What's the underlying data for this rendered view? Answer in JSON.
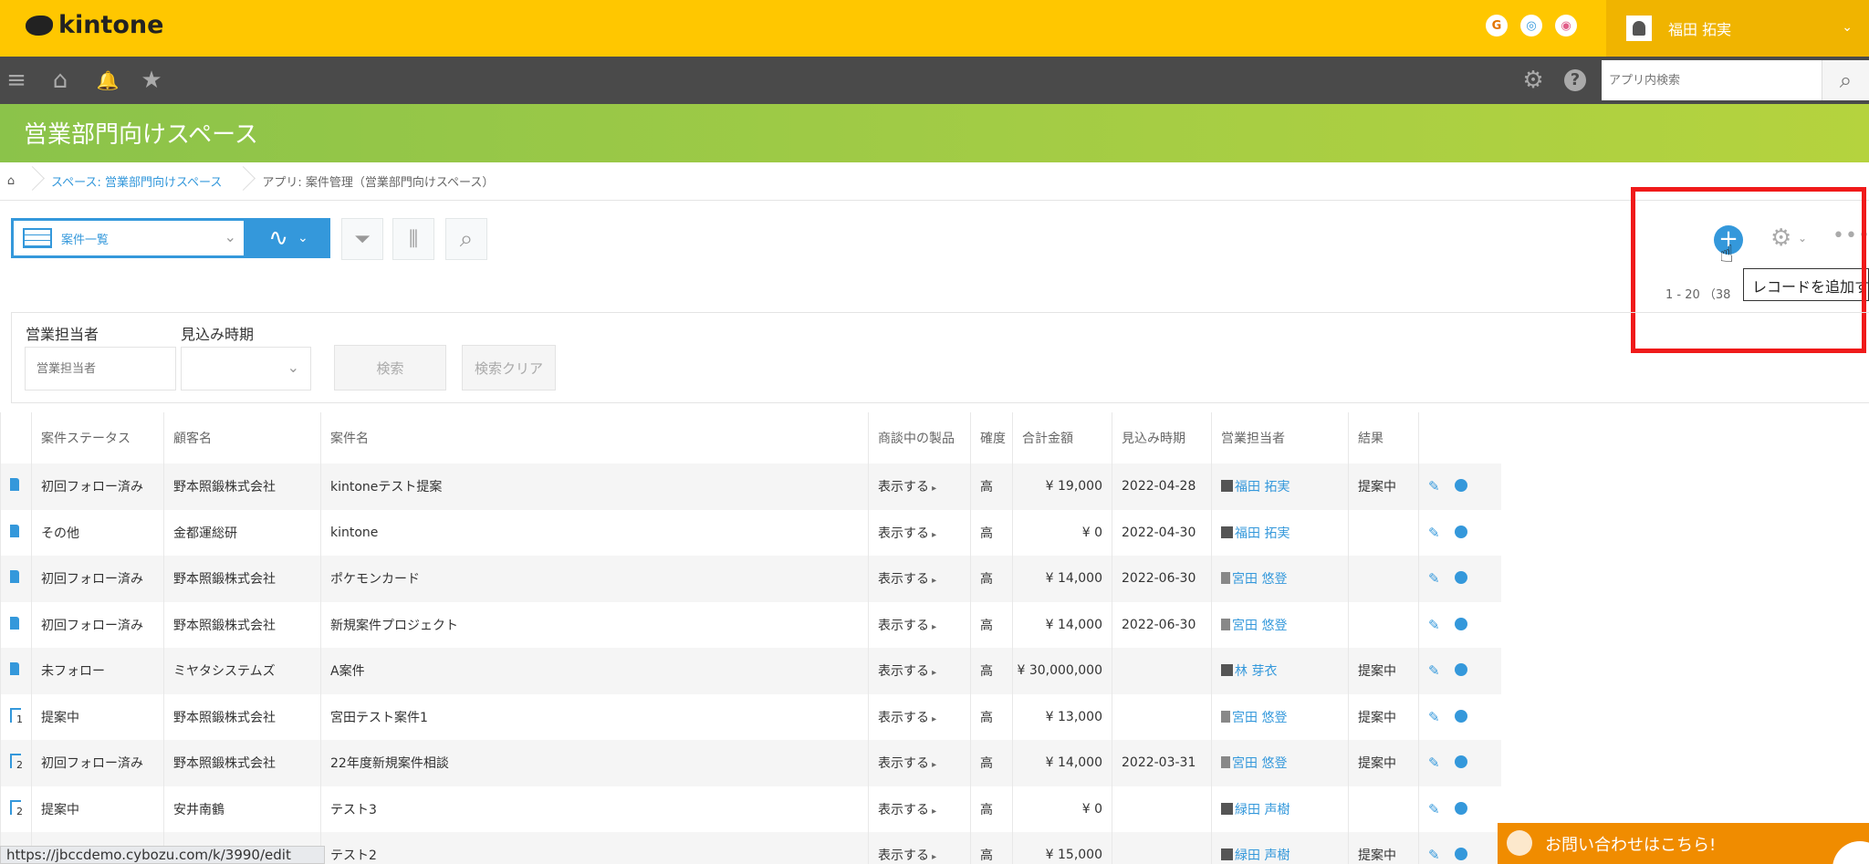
{
  "header": {
    "logo_text": "kintone",
    "service_icons": [
      "G",
      "◎",
      "◉"
    ],
    "user_name": "福田 拓実",
    "user_chevron": "⌄"
  },
  "navbar": {
    "menu_icon": "≡",
    "home_icon": "⌂",
    "bell_icon": "🔔",
    "star_icon": "★",
    "gear_icon": "⚙",
    "help_icon": "?",
    "search_placeholder": "アプリ内検索",
    "search_icon": "⌕"
  },
  "space": {
    "title": "営業部門向けスペース"
  },
  "breadcrumb": {
    "home_icon": "⌂",
    "space": "スペース: 営業部門向けスペース",
    "app": "アプリ: 案件管理（営業部門向けスペース）"
  },
  "toolbar": {
    "view_label": "案件一覧",
    "graph_label": "∿",
    "filter_icon": "⏷",
    "chart_icon": "⫼",
    "search_icon": "⌕",
    "add_icon": "+",
    "gear_icon": "⚙",
    "gear_chevron": "⌄",
    "more_icon": "•••",
    "tooltip": "レコードを追加す",
    "page_count": "1 - 20 （38"
  },
  "filters": {
    "sales_rep_label": "営業担当者",
    "sales_rep_placeholder": "営業担当者",
    "forecast_label": "見込み時期",
    "search_button": "検索",
    "clear_button": "検索クリア"
  },
  "table": {
    "headers": [
      "案件ステータス",
      "顧客名",
      "案件名",
      "商談中の製品",
      "確度",
      "合計金額",
      "見込み時期",
      "営業担当者",
      "結果"
    ],
    "rows": [
      {
        "status": "初回フォロー済み",
        "customer": "野本照鍛株式会社",
        "name": "kintoneテスト提案",
        "product": "表示する",
        "prob": "高",
        "amount": "¥ 19,000",
        "date": "2022-04-28",
        "rep": "福田 拓実",
        "result": "提案中"
      },
      {
        "status": "その他",
        "customer": "金都運総研",
        "name": "kintone",
        "product": "表示する",
        "prob": "高",
        "amount": "¥ 0",
        "date": "2022-04-30",
        "rep": "福田 拓実",
        "result": ""
      },
      {
        "status": "初回フォロー済み",
        "customer": "野本照鍛株式会社",
        "name": "ポケモンカード",
        "product": "表示する",
        "prob": "高",
        "amount": "¥ 14,000",
        "date": "2022-06-30",
        "rep": "宮田 悠登",
        "result": ""
      },
      {
        "status": "初回フォロー済み",
        "customer": "野本照鍛株式会社",
        "name": "新規案件プロジェクト",
        "product": "表示する",
        "prob": "高",
        "amount": "¥ 14,000",
        "date": "2022-06-30",
        "rep": "宮田 悠登",
        "result": ""
      },
      {
        "status": "未フォロー",
        "customer": "ミヤタシステムズ",
        "name": "A案件",
        "product": "表示する",
        "prob": "高",
        "amount": "¥ 30,000,000",
        "date": "",
        "rep": "林 芽衣",
        "result": "提案中"
      },
      {
        "status": "提案中",
        "customer": "野本照鍛株式会社",
        "name": "宮田テスト案件1",
        "product": "表示する",
        "prob": "高",
        "amount": "¥ 13,000",
        "date": "",
        "rep": "宮田 悠登",
        "result": "提案中"
      },
      {
        "status": "初回フォロー済み",
        "customer": "野本照鍛株式会社",
        "name": "22年度新規案件相談",
        "product": "表示する",
        "prob": "高",
        "amount": "¥ 14,000",
        "date": "2022-03-31",
        "rep": "宮田 悠登",
        "result": "提案中"
      },
      {
        "status": "提案中",
        "customer": "安井南鶴",
        "name": "テスト3",
        "product": "表示する",
        "prob": "高",
        "amount": "¥ 0",
        "date": "",
        "rep": "緑田 声樹",
        "result": ""
      },
      {
        "status": "",
        "customer": "",
        "name": "テスト2",
        "product": "表示する",
        "prob": "高",
        "amount": "¥ 15,000",
        "date": "",
        "rep": "緑田 声樹",
        "result": "提案中"
      }
    ],
    "row_number_marks": [
      "1",
      "2",
      "2"
    ]
  },
  "status_url": "https://jbccdemo.cybozu.com/k/3990/edit",
  "contact_banner": "お問い合わせはこちら!",
  "colors": {
    "header": "#ffc700",
    "space_banner": "#8bc34a",
    "accent": "#3498db",
    "highlight_box": "#f01a1a",
    "contact": "#f08c00"
  }
}
